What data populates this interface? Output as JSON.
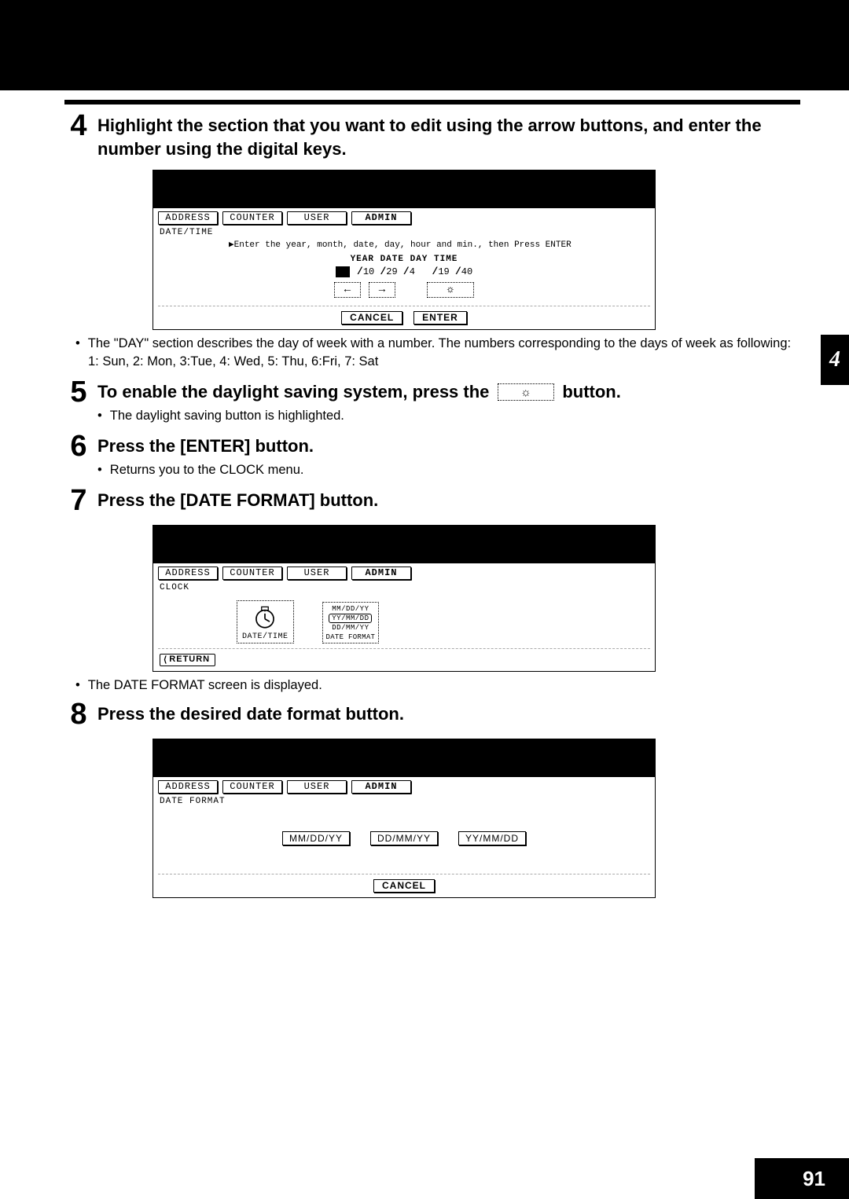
{
  "page_number": "91",
  "chapter_tab": "4",
  "steps": {
    "s4": {
      "num": "4",
      "title": "Highlight the section that you want to edit using the arrow buttons, and enter the number using the digital keys.",
      "bullet1": "The \"DAY\" section describes the day of week with a number.  The numbers corresponding to the days of week as following:",
      "bullet1_sub": "1: Sun, 2: Mon, 3:Tue, 4: Wed, 5: Thu, 6:Fri, 7: Sat"
    },
    "s5": {
      "num": "5",
      "title_a": "To enable the daylight saving system, press the",
      "title_b": "button.",
      "bullet1": "The daylight saving button is highlighted."
    },
    "s6": {
      "num": "6",
      "title": "Press the [ENTER] button.",
      "bullet1": "Returns you to the CLOCK menu."
    },
    "s7": {
      "num": "7",
      "title": "Press the [DATE FORMAT] button.",
      "bullet1": "The DATE FORMAT screen is displayed."
    },
    "s8": {
      "num": "8",
      "title": "Press the desired date format button."
    }
  },
  "screens": {
    "tabs": [
      "ADDRESS",
      "COUNTER",
      "USER",
      "ADMIN"
    ],
    "datetime": {
      "crumb": "DATE/TIME",
      "instruction": "▶Enter the year, month, date, day, hour and min., then Press ENTER",
      "labels": "YEAR   DATE   DAY   TIME",
      "values": [
        "10",
        "29",
        "4",
        "19",
        "40"
      ],
      "cancel": "CANCEL",
      "enter": "ENTER"
    },
    "clock": {
      "crumb": "CLOCK",
      "datetime_label": "DATE/TIME",
      "fmt_opts": [
        "MM/DD/YY",
        "YY/MM/DD",
        "DD/MM/YY"
      ],
      "fmt_label": "DATE FORMAT",
      "return": "RETURN"
    },
    "dateformat": {
      "crumb": "DATE FORMAT",
      "opts": [
        "MM/DD/YY",
        "DD/MM/YY",
        "YY/MM/DD"
      ],
      "cancel": "CANCEL"
    }
  }
}
